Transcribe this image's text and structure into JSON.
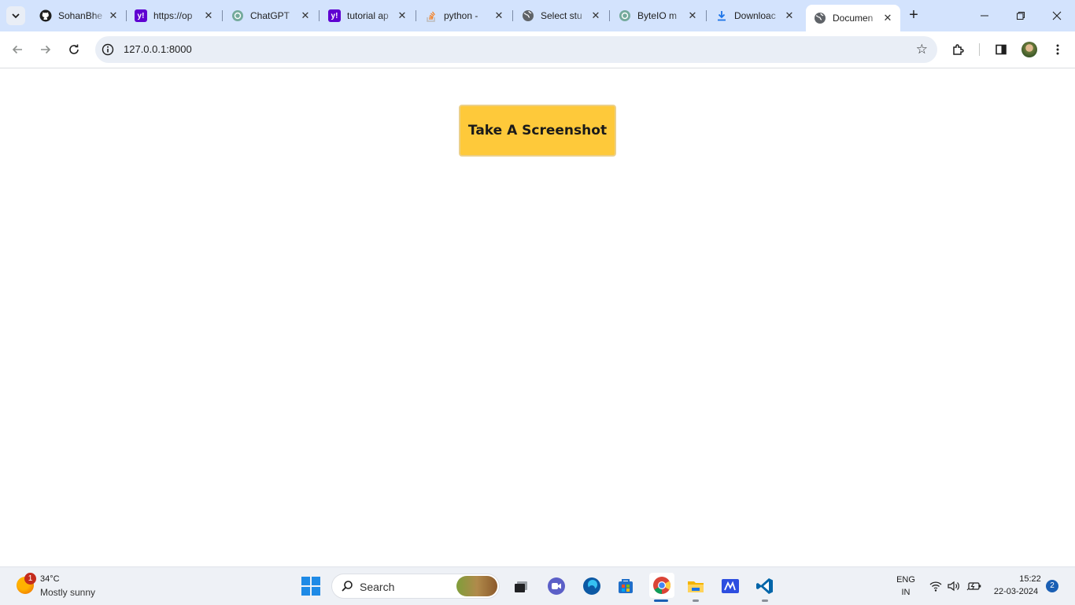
{
  "browser": {
    "tabs": [
      {
        "title": "SohanBhe",
        "favicon": "github-icon"
      },
      {
        "title": "https://op",
        "favicon": "yahoo-icon"
      },
      {
        "title": "ChatGPT",
        "favicon": "chatgpt-icon"
      },
      {
        "title": "tutorial ap",
        "favicon": "yahoo-icon"
      },
      {
        "title": "python - ",
        "favicon": "stackoverflow-icon"
      },
      {
        "title": "Select stu",
        "favicon": "globe-icon"
      },
      {
        "title": "ByteIO m",
        "favicon": "chatgpt-icon"
      },
      {
        "title": "Downloac",
        "favicon": "download-icon"
      },
      {
        "title": "Documen",
        "favicon": "globe-icon",
        "active": true
      }
    ],
    "url": "127.0.0.1:8000"
  },
  "page": {
    "button_label": "Take A Screenshot",
    "button_color": "#fec93a"
  },
  "taskbar": {
    "weather": {
      "temp": "34°C",
      "desc": "Mostly sunny",
      "badge": "1"
    },
    "search_label": "Search",
    "apps": [
      "task-view-icon",
      "meet-icon",
      "edge-icon",
      "store-icon",
      "chrome-icon",
      "file-explorer-icon",
      "editor-icon",
      "vscode-icon"
    ],
    "language": {
      "line1": "ENG",
      "line2": "IN"
    },
    "clock": {
      "time": "15:22",
      "date": "22-03-2024"
    },
    "notifications": "2"
  }
}
